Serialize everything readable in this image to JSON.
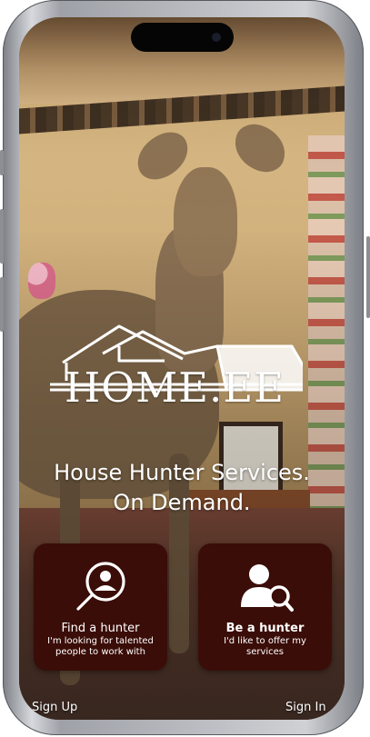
{
  "brand": {
    "logo_icon": "house-roof-logo-icon",
    "name": "HOME.EE"
  },
  "hero": {
    "tagline_line1": "House Hunter Services.",
    "tagline_line2": "On Demand."
  },
  "cards": [
    {
      "icon": "person-search-icon",
      "title": "Find a hunter",
      "description": "I'm looking for talented people to work with"
    },
    {
      "icon": "user-magnifier-icon",
      "title": "Be a hunter",
      "description": "I'd like to offer my services"
    }
  ],
  "footer": {
    "sign_up": "Sign Up",
    "sign_in": "Sign In"
  },
  "colors": {
    "card_bg": "#3a0d08",
    "text": "#ffffff"
  }
}
